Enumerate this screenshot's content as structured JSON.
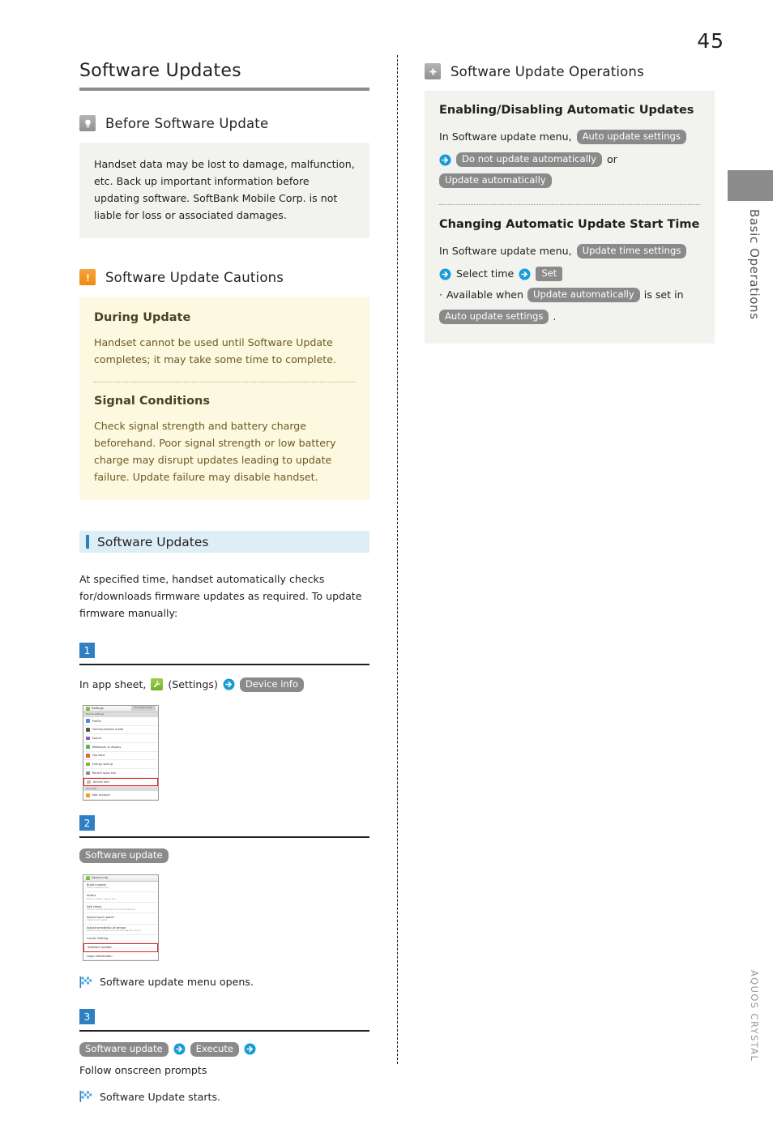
{
  "page": {
    "number": "45",
    "side_tab_label": "Basic Operations",
    "brand": "AQUOS CRYSTAL"
  },
  "left": {
    "chapter_title": "Software Updates",
    "before_update": {
      "icon": "lightbulb-icon",
      "heading": "Before Software Update",
      "body": "Handset data may be lost to damage, malfunction, etc. Back up important information before updating software. SoftBank Mobile Corp. is not liable for loss or associated damages."
    },
    "cautions": {
      "icon": "exclamation-icon",
      "heading": "Software Update Cautions",
      "during_update": {
        "sub_heading": "During Update",
        "body": "Handset cannot be used until Software Update completes; it may take some time to complete."
      },
      "signal_conditions": {
        "sub_heading": "Signal Conditions",
        "body": "Check signal strength and battery charge beforehand. Poor signal strength or low battery charge may disrupt updates leading to update failure. Update failure may disable handset."
      }
    },
    "software_updates": {
      "bar_heading": "Software Updates",
      "intro": "At specified time, handset automatically checks for/downloads firmware updates as required. To update firmware manually:",
      "steps": [
        {
          "number": "1",
          "prefix": "In app sheet,",
          "app_icon": "wrench-settings-icon",
          "app_label": "(Settings)",
          "arrow": "arrow-right-icon",
          "chip": "Device info"
        },
        {
          "number": "2",
          "chip": "Software update",
          "result": "Software update menu opens."
        },
        {
          "number": "3",
          "chip1": "Software update",
          "chip2": "Execute",
          "tail": "Follow onscreen prompts",
          "result": "Software Update starts."
        }
      ]
    },
    "shot1": {
      "title": "Settings",
      "pill": "To Simple mode",
      "group1": "Device settings",
      "group2": "Accounts",
      "rows": [
        {
          "label": "Profile",
          "color": "#4a90d9"
        },
        {
          "label": "harman/kardon audio",
          "color": "#555555"
        },
        {
          "label": "Sound",
          "color": "#8f56b5"
        },
        {
          "label": "Wallpaper & display",
          "color": "#62b44a"
        },
        {
          "label": "Clip Now",
          "color": "#e06a2c"
        },
        {
          "label": "Energy saving",
          "color": "#7cb342"
        },
        {
          "label": "Recent apps key",
          "color": "#8a8a8a"
        },
        {
          "label": "Device info",
          "color": "#bdbdbd",
          "highlight": true
        }
      ],
      "account_row": {
        "label": "Add account",
        "color": "#f0a32c"
      }
    },
    "shot2": {
      "title": "Device info",
      "rows": [
        {
          "l1": "Build number",
          "l2": "XXXX released micro"
        },
        {
          "l1": "Status",
          "l2": "Phone number, signal, etc."
        },
        {
          "l1": "Self check",
          "l2": "Carries out the self-check of various devices."
        },
        {
          "l1": "Adjust touch panel",
          "l2": "Adjust touch panel."
        },
        {
          "l1": "Adjust sensitivity of sensor",
          "l2": "Adjust motion sensor and electromagnetic sensor."
        },
        {
          "l1": "Carrier Setting",
          "l2": ""
        },
        {
          "l1": "Software update",
          "l2": "",
          "highlight": true
        },
        {
          "l1": "Legal information",
          "l2": ""
        }
      ]
    }
  },
  "right": {
    "icon": "plus-icon",
    "heading": "Software Update Operations",
    "block1": {
      "sub_heading": "Enabling/Disabling Automatic Updates",
      "prefix": "In Software update menu,",
      "chip1": "Auto update settings",
      "arrow": "arrow-right-icon",
      "chip2": "Do not update automatically",
      "conjunction": "or",
      "chip3": "Update automatically"
    },
    "block2": {
      "sub_heading": "Changing Automatic Update Start Time",
      "prefix": "In Software update menu,",
      "chip1": "Update time settings",
      "mid": "Select time",
      "chip2": "Set",
      "note_bullet": "·",
      "note_prefix": "Available when",
      "note_chip1": "Update automatically",
      "note_mid": "is set in",
      "note_chip2": "Auto update settings",
      "note_suffix": "."
    }
  },
  "colors": {
    "accent_blue": "#2f80c2",
    "rule_gray": "#8c8c8c",
    "caution_orange": "#ef8a12",
    "box_gray": "#f2f2ee",
    "box_yellow": "#fdf8e0",
    "bluebar": "#ddeef7",
    "chip_gray": "#8a8a8a",
    "highlight_red": "#e0221b"
  }
}
